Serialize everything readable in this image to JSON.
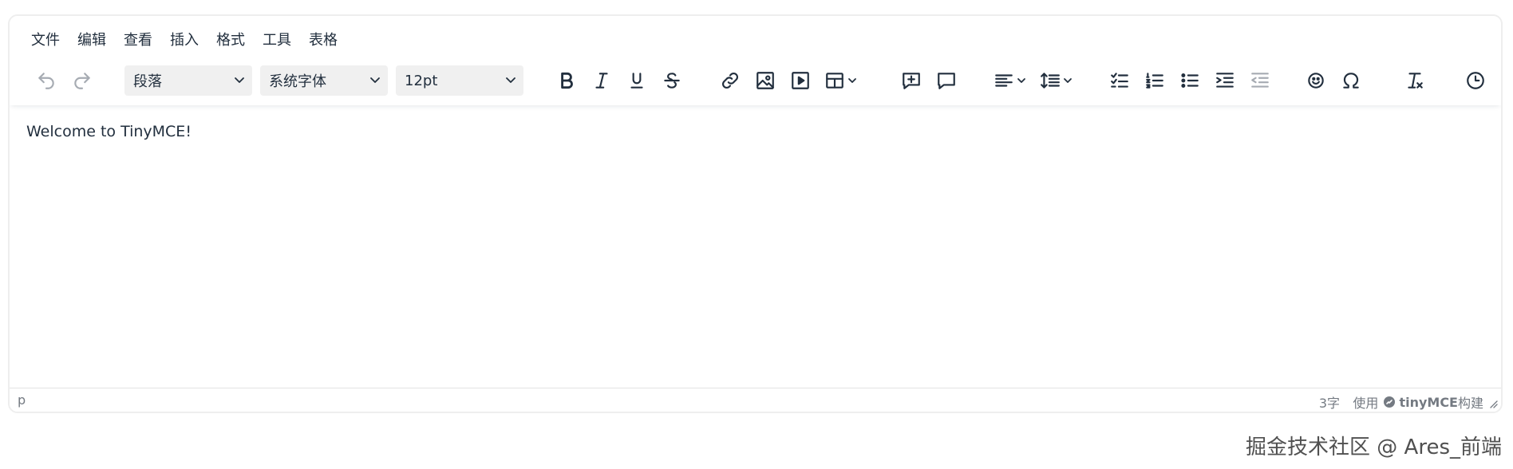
{
  "menubar": {
    "items": [
      "文件",
      "编辑",
      "查看",
      "插入",
      "格式",
      "工具",
      "表格"
    ]
  },
  "toolbar": {
    "block_format": "段落",
    "font_family": "系统字体",
    "font_size": "12pt",
    "icons": [
      "undo-icon",
      "redo-icon",
      "bold-icon",
      "italic-icon",
      "underline-icon",
      "strikethrough-icon",
      "link-icon",
      "image-icon",
      "media-icon",
      "table-icon",
      "add-comment-icon",
      "comments-icon",
      "align-left-icon",
      "line-height-icon",
      "checklist-icon",
      "numbered-list-icon",
      "bullet-list-icon",
      "indent-icon",
      "outdent-icon",
      "emoticons-icon",
      "special-character-icon",
      "remove-format-icon",
      "history-icon"
    ]
  },
  "editor": {
    "content": "Welcome to TinyMCE!"
  },
  "statusbar": {
    "path": "p",
    "word_count": "3字",
    "brand_prefix": "使用",
    "brand_name": "tinyMCE",
    "brand_suffix": "构建"
  },
  "watermark": "掘金技术社区 @ Ares_前端",
  "colors": {
    "text": "#222f3e",
    "disabled": "#a6abb2",
    "select_bg": "#f0f0f0",
    "status_text": "#747a82",
    "border": "#eeeeee"
  }
}
